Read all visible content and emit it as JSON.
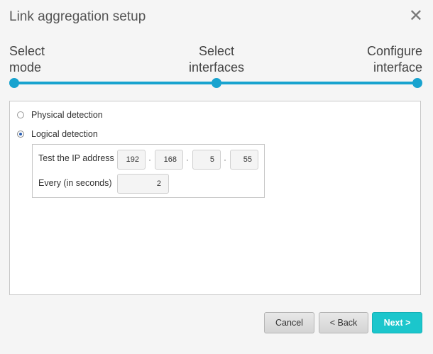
{
  "dialog": {
    "title": "Link aggregation setup",
    "close_symbol": "✕"
  },
  "steps": [
    {
      "line1": "Select",
      "line2": "mode"
    },
    {
      "line1": "Select",
      "line2": "interfaces"
    },
    {
      "line1": "Configure",
      "line2": "interface"
    }
  ],
  "options": {
    "physical_label": "Physical detection",
    "logical_label": "Logical detection",
    "selected": "logical"
  },
  "logical": {
    "ip_label": "Test the IP address",
    "ip_octets": [
      "192",
      "168",
      "5",
      "55"
    ],
    "separator": "·",
    "interval_label": "Every (in seconds)",
    "interval_value": "2"
  },
  "buttons": {
    "cancel": "Cancel",
    "back": "< Back",
    "next": "Next >"
  },
  "colors": {
    "progress": "#18a3cf",
    "primary_button": "#1bc6cc"
  },
  "icons": {
    "close": "close-icon",
    "radio": "radio-button"
  }
}
